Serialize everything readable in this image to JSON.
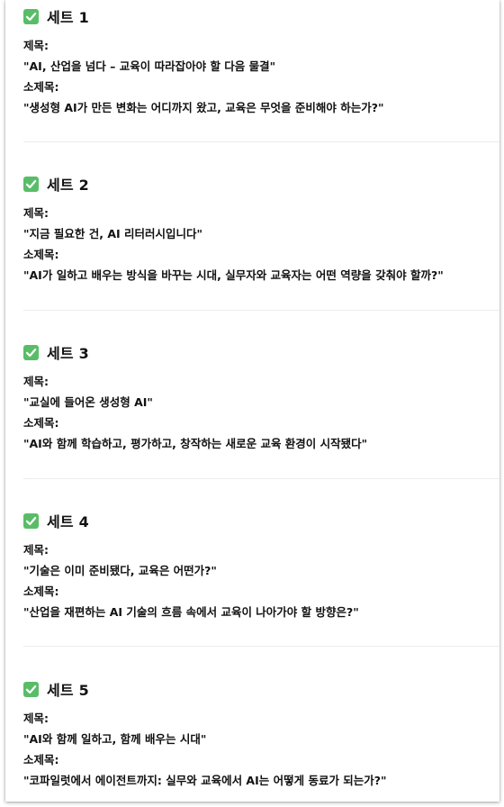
{
  "field_labels": {
    "title": "제목:",
    "subtitle": "소제목:"
  },
  "icon": "white-heavy-check-mark-icon",
  "colors": {
    "check_bg": "#59bd68",
    "check_mark": "#ffffff",
    "text": "#111111"
  },
  "sets": [
    {
      "heading": "세트 1",
      "title": "\"AI, 산업을 넘다 – 교육이 따라잡아야 할 다음 물결\"",
      "subtitle": "\"생성형 AI가 만든 변화는 어디까지 왔고, 교육은 무엇을 준비해야 하는가?\""
    },
    {
      "heading": "세트 2",
      "title": "\"지금 필요한 건, AI 리터러시입니다\"",
      "subtitle": "\"AI가 일하고 배우는 방식을 바꾸는 시대, 실무자와 교육자는 어떤 역량을 갖춰야 할까?\""
    },
    {
      "heading": "세트 3",
      "title": "\"교실에 들어온 생성형 AI\"",
      "subtitle": "\"AI와 함께 학습하고, 평가하고, 창작하는 새로운 교육 환경이 시작됐다\""
    },
    {
      "heading": "세트 4",
      "title": "\"기술은 이미 준비됐다, 교육은 어떤가?\"",
      "subtitle": "\"산업을 재편하는 AI 기술의 흐름 속에서 교육이 나아가야 할 방향은?\""
    },
    {
      "heading": "세트 5",
      "title": "\"AI와 함께 일하고, 함께 배우는 시대\"",
      "subtitle": "\"코파일럿에서 에이전트까지: 실무와 교육에서 AI는 어떻게 동료가 되는가?\""
    }
  ]
}
